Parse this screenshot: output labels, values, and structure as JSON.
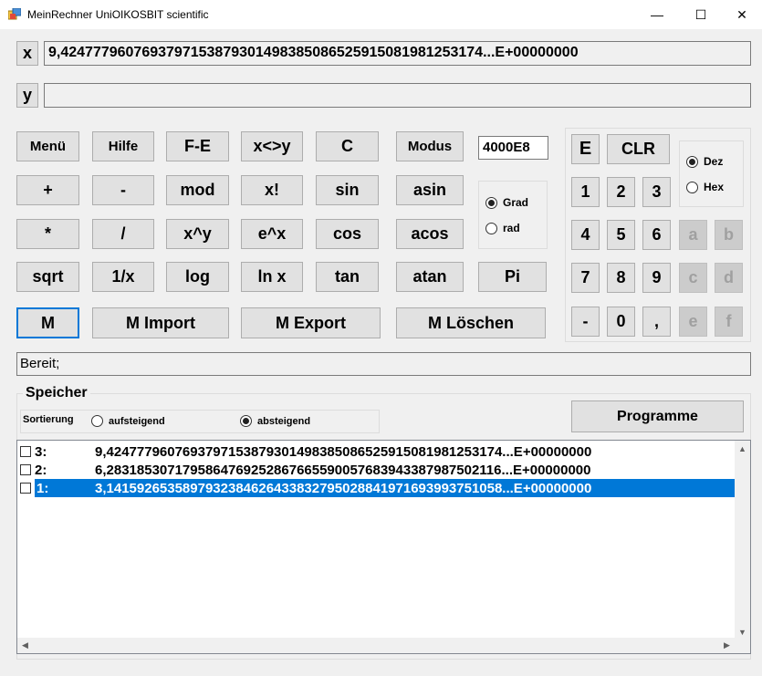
{
  "window": {
    "title": "MeinRechner UniOIKOSBIT scientific",
    "minimize": "—",
    "maximize": "☐",
    "close": "✕"
  },
  "x_label": "x",
  "x_value": "9,4247779607693797153879301498385086525915081981253174...E+00000000",
  "y_label": "y",
  "y_value": "",
  "buttons": {
    "menu": "Menü",
    "help": "Hilfe",
    "fe": "F-E",
    "swap": "x<>y",
    "c": "C",
    "modus": "Modus",
    "plus": "+",
    "minus": "-",
    "mod": "mod",
    "fact": "x!",
    "sin": "sin",
    "asin": "asin",
    "mul": "*",
    "div": "/",
    "pow": "x^y",
    "exp": "e^x",
    "cos": "cos",
    "acos": "acos",
    "sqrt": "sqrt",
    "recip": "1/x",
    "log": "log",
    "ln": "ln x",
    "tan": "tan",
    "atan": "atan",
    "pi": "Pi",
    "m": "M",
    "m_import": "M Import",
    "m_export": "M Export",
    "m_delete": "M Löschen"
  },
  "precision_value": "4000E8",
  "angle": {
    "grad": "Grad",
    "rad": "rad",
    "selected": "grad"
  },
  "numpad": {
    "e": "E",
    "clr": "CLR",
    "keys": [
      "1",
      "2",
      "3",
      "4",
      "5",
      "6",
      "7",
      "8",
      "9",
      "-",
      "0",
      ","
    ],
    "hex_keys": [
      "a",
      "b",
      "c",
      "d",
      "e",
      "f"
    ]
  },
  "base": {
    "dez": "Dez",
    "hex": "Hex",
    "selected": "dez"
  },
  "status": "Bereit;",
  "memory": {
    "title": "Speicher",
    "sort_label": "Sortierung",
    "asc": "aufsteigend",
    "desc": "absteigend",
    "sort_selected": "desc",
    "programs": "Programme",
    "items": [
      {
        "num": "3:",
        "value": "9,4247779607693797153879301498385086525915081981253174...E+00000000"
      },
      {
        "num": "2:",
        "value": "6,2831853071795864769252867665590057683943387987502116...E+00000000"
      },
      {
        "num": "1:",
        "value": "3,1415926535897932384626433832795028841971693993751058...E+00000000"
      }
    ]
  }
}
